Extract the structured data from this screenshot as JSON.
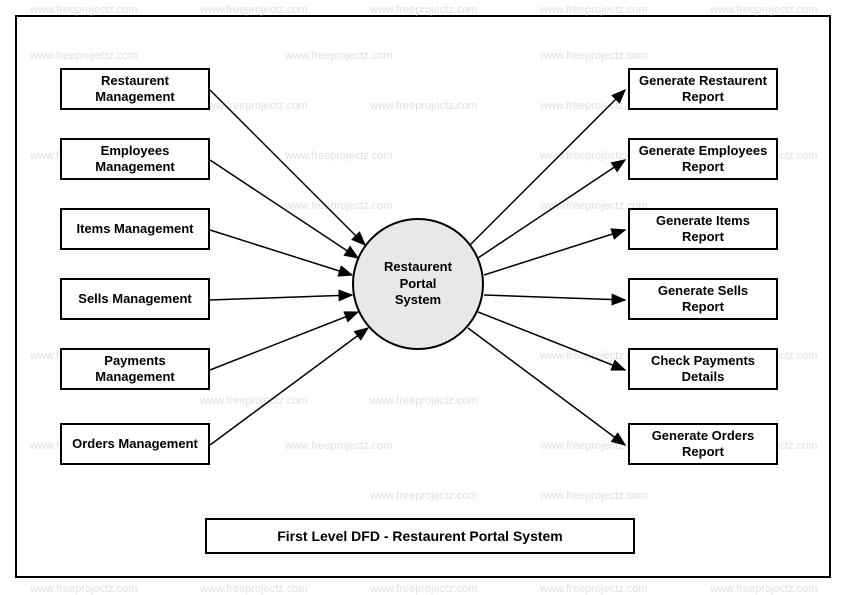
{
  "watermark_text": "www.freeprojectz.com",
  "center": {
    "label": "Restaurent\nPortal\nSystem"
  },
  "left_boxes": [
    {
      "label": "Restaurent Management"
    },
    {
      "label": "Employees Management"
    },
    {
      "label": "Items Management"
    },
    {
      "label": "Sells Management"
    },
    {
      "label": "Payments Management"
    },
    {
      "label": "Orders Management"
    }
  ],
  "right_boxes": [
    {
      "label": "Generate Restaurent Report"
    },
    {
      "label": "Generate Employees Report"
    },
    {
      "label": "Generate Items Report"
    },
    {
      "label": "Generate Sells Report"
    },
    {
      "label": "Check Payments Details"
    },
    {
      "label": "Generate Orders Report"
    }
  ],
  "title": "First Level DFD - Restaurent Portal System",
  "diagram_type": "Data Flow Diagram (Level 1)"
}
